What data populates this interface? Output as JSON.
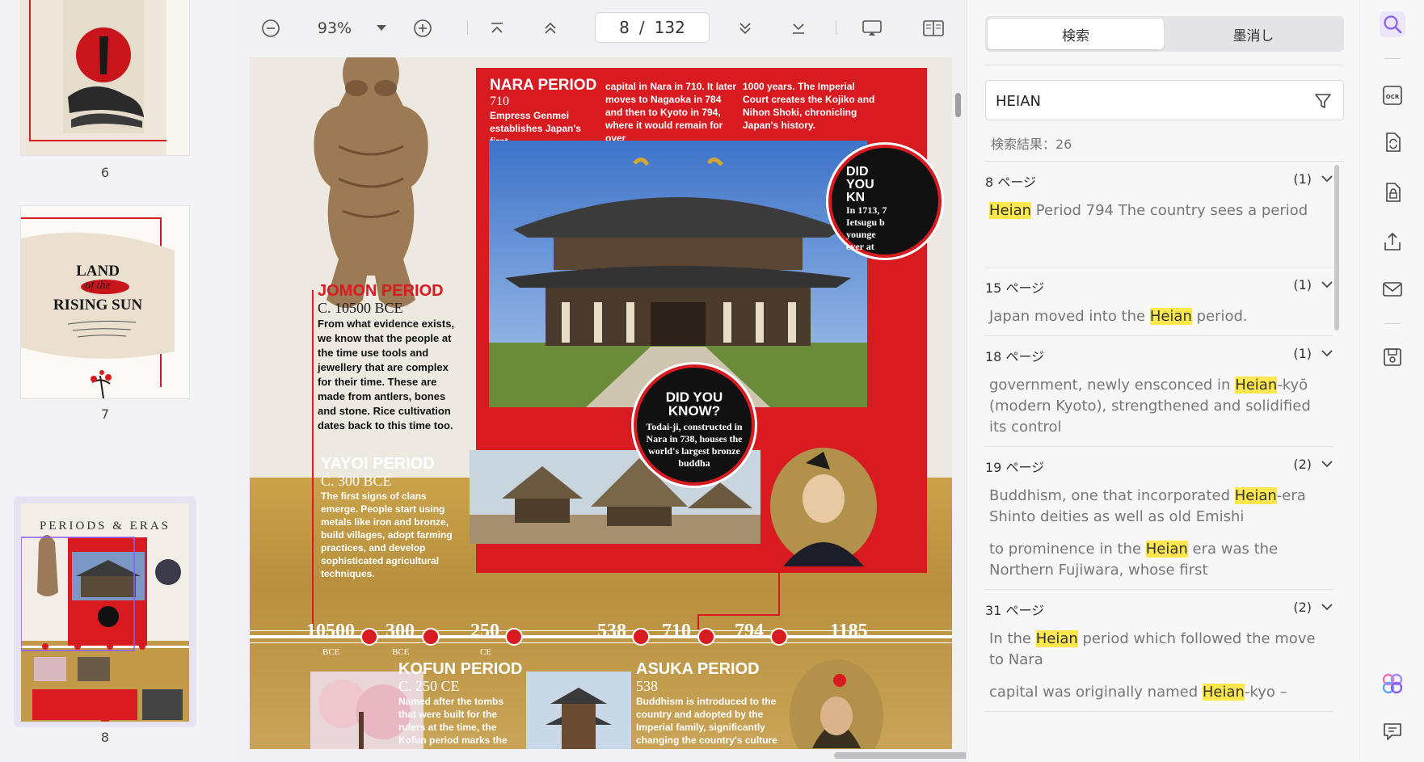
{
  "thumbnails": [
    {
      "page": "6"
    },
    {
      "page": "7",
      "title_line1": "LAND",
      "title_line2": "of the",
      "title_line3": "RISING SUN"
    },
    {
      "page": "8",
      "title": "PERIODS & ERAS"
    }
  ],
  "toolbar": {
    "zoom": "93%",
    "current_page": "8",
    "separator": "/",
    "total_pages": "132"
  },
  "page": {
    "nara": {
      "title": "NARA PERIOD",
      "year": "710",
      "col1": "Empress Genmei establishes Japan's first",
      "col2": "capital in Nara in 710. It later moves to Nagaoka in 784 and then to Kyoto in 794, where it would remain for over",
      "col3": "1000 years. The Imperial Court creates the Kojiko and Nihon Shoki, chronicling Japan's history."
    },
    "jomon": {
      "title": "JOMON PERIOD",
      "year": "C. 10500 BCE",
      "body": "From what evidence exists, we know that the people at the time use tools and jewellery that are complex for their time. These are made from antlers, bones and stone. Rice cultivation dates back to this time too."
    },
    "yayoi": {
      "title": "YAYOI PERIOD",
      "year": "C. 300 BCE",
      "body": "The first signs of clans emerge. People start using metals like iron and bronze, build villages, adopt farming practices, and develop sophisticated agricultural techniques."
    },
    "kofun": {
      "title": "KOFUN PERIOD",
      "year": "C. 250 CE",
      "body": "Named after the tombs that were built for the rulers at the time, the Kofun period marks the"
    },
    "asuka": {
      "title": "ASUKA PERIOD",
      "year": "538",
      "body": "Buddhism is introduced to the country and adopted by the Imperial family, significantly changing the country's culture"
    },
    "dyk_center": {
      "title": "DID YOU KNOW?",
      "body": "Todai-ji, constructed in Nara in 738, houses the world's largest bronze buddha"
    },
    "dyk_right": {
      "title": "DID YOU KN",
      "body": "In 1713, 7 Ietsugu b younge ever at"
    },
    "timeline": [
      {
        "label": "10500",
        "sub": "BCE"
      },
      {
        "label": "300",
        "sub": "BCE"
      },
      {
        "label": "250",
        "sub": "CE"
      },
      {
        "label": "538",
        "sub": ""
      },
      {
        "label": "710",
        "sub": ""
      },
      {
        "label": "794",
        "sub": ""
      },
      {
        "label": "1185",
        "sub": ""
      }
    ]
  },
  "search_panel": {
    "tab_search": "検索",
    "tab_redact": "墨消し",
    "query": "HEIAN",
    "result_count": "検索結果：26",
    "groups": [
      {
        "page": "8 ページ",
        "count": "(1)",
        "snippets": [
          [
            "",
            "Heian",
            " Period 794 The country sees a period"
          ]
        ]
      },
      {
        "page": "15 ページ",
        "count": "(1)",
        "snippets": [
          [
            "Japan moved into the ",
            "Heian",
            " period."
          ]
        ]
      },
      {
        "page": "18 ページ",
        "count": "(1)",
        "snippets": [
          [
            "government, newly ensconced in ",
            "Heian",
            "-kyō (modern Kyoto), strengthened and solidified its control"
          ]
        ]
      },
      {
        "page": "19 ページ",
        "count": "(2)",
        "snippets": [
          [
            "Buddhism, one that incorporated ",
            "Heian",
            "-era Shinto deities as well as old Emishi"
          ],
          [
            "to prominence in the ",
            "Heian",
            " era was the Northern Fujiwara, whose first"
          ]
        ]
      },
      {
        "page": "31 ページ",
        "count": "(2)",
        "snippets": [
          [
            "In the ",
            "Heian",
            " period which followed the move to Nara"
          ],
          [
            "capital was originally named ",
            "Heian",
            "-kyo –"
          ]
        ]
      }
    ]
  },
  "colors": {
    "accent": "#8b5cf6",
    "highlight": "#fde74c",
    "page_red": "#d81a21"
  },
  "rail_icons": [
    "search-icon",
    "ocr-icon",
    "convert-icon",
    "protect-icon",
    "share-icon",
    "mail-icon",
    "save-icon",
    "ai-assistant-icon",
    "comment-icon"
  ]
}
